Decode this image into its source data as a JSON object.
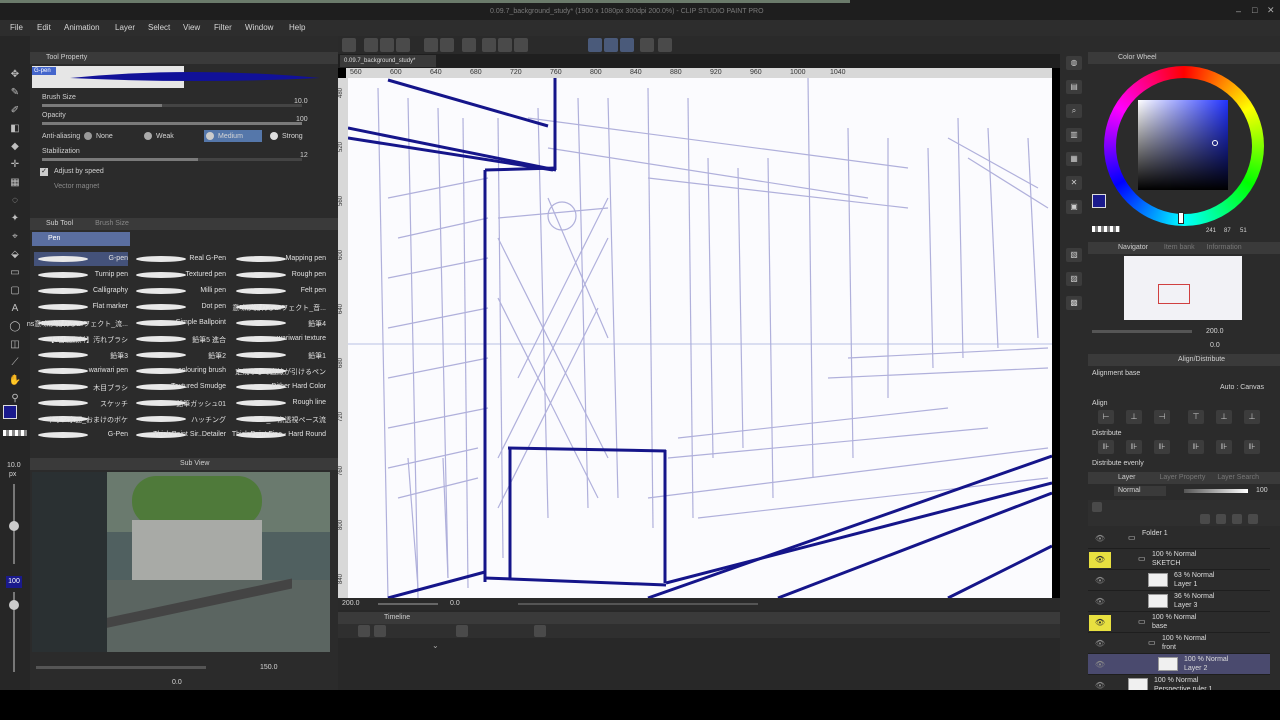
{
  "window": {
    "title": "0.09.7_background_study* (1900 x 1080px 300dpi 200.0%) - CLIP STUDIO PAINT PRO"
  },
  "menu": [
    "File",
    "Edit",
    "Animation",
    "Layer",
    "Select",
    "View",
    "Filter",
    "Window",
    "Help"
  ],
  "tool_property": {
    "title": "Tool Property",
    "brush_name": "G-pen",
    "brush_size_label": "Brush Size",
    "brush_size_value": "10.0",
    "opacity_label": "Opacity",
    "opacity_value": "100",
    "antialias_label": "Anti-aliasing",
    "antialias_options": [
      "None",
      "Weak",
      "Medium",
      "Strong"
    ],
    "antialias_selected": "Medium",
    "stabilization_label": "Stabilization",
    "stabilization_value": "12",
    "adjust_by_speed": "Adjust by speed",
    "vector_magnet": "Vector magnet"
  },
  "sub_tool": {
    "title": "Sub Tool",
    "tab2": "Brush Size",
    "group": "Pen",
    "col1": [
      "G-pen",
      "Turnip pen",
      "Calligraphy",
      "Flat marker",
      "ns意味が流れるエフェクト_流...",
      "【3日間無料】汚れブラシ",
      "鉛筆3",
      "wariwari pen",
      "木目ブラシ",
      "スケッチ",
      "ネオン水面_おまけのボケ",
      "G-Pen"
    ],
    "col2": [
      "Real G-Pen",
      "Textured pen",
      "Milli pen",
      "Dot pen",
      "Simple Ballpoint",
      "鉛筆5 進合",
      "鉛筆2",
      "colouring brush",
      "Textured Smudge",
      "鉛筆ガッシュ01",
      "ハッチング",
      "Thick Paint Sir..Detailer"
    ],
    "col3": [
      "Mapping pen",
      "Rough pen",
      "Felt pen",
      "意味が流れるエフェクト_音...",
      "鉛筆4",
      "wariwari texture",
      "鉛筆1",
      "定規なしで直線が引けるペン",
      "Dither Hard Color",
      "Rough line",
      "T_一点透視ペース流",
      "Thick Paint Fine - Hard Round"
    ]
  },
  "sub_view": {
    "title": "Sub View",
    "zoom": "150.0",
    "angle": "0.0"
  },
  "left_toolbar": {
    "brush_size": "10.0",
    "brush_unit": "px",
    "opacity": "100"
  },
  "canvas": {
    "tab_label": "0.09.7_background_study*",
    "ruler_marks": [
      "560",
      "600",
      "640",
      "680",
      "720",
      "760",
      "800",
      "840",
      "880",
      "920",
      "960",
      "1000",
      "1040"
    ],
    "vruler_marks": [
      "480",
      "520",
      "560",
      "600",
      "640",
      "680",
      "720",
      "760",
      "800",
      "840"
    ],
    "zoom": "200.0",
    "angle": "0.0"
  },
  "timeline": {
    "title": "Timeline"
  },
  "color_wheel": {
    "title": "Color Wheel",
    "values": [
      "241",
      "87",
      "51"
    ],
    "main_color": "#1a1a8c"
  },
  "navigator": {
    "title": "Navigator",
    "tab2": "Item bank",
    "tab3": "Information",
    "zoom": "200.0",
    "angle": "0.0"
  },
  "align": {
    "title": "Align/Distribute",
    "alignment_base": "Alignment base",
    "auto_canvas": "Auto : Canvas",
    "align_label": "Align",
    "distribute_label": "Distribute",
    "distribute_evenly": "Distribute evenly"
  },
  "layer_panel": {
    "title": "Layer",
    "tab2": "Layer Property",
    "tab3": "Layer Search",
    "blend": "Normal",
    "opacity": "100",
    "layers": [
      {
        "line1": "Folder 1",
        "line2": "",
        "eye": false,
        "selected": false,
        "indent": 0,
        "thumb": false
      },
      {
        "line1": "100 % Normal",
        "line2": "SKETCH",
        "eye": true,
        "selected": false,
        "indent": 1,
        "thumb": false
      },
      {
        "line1": "63 % Normal",
        "line2": "Layer 1",
        "eye": false,
        "selected": false,
        "indent": 2,
        "thumb": true
      },
      {
        "line1": "36 % Normal",
        "line2": "Layer 3",
        "eye": false,
        "selected": false,
        "indent": 2,
        "thumb": true
      },
      {
        "line1": "100 % Normal",
        "line2": "base",
        "eye": true,
        "selected": false,
        "indent": 1,
        "thumb": false
      },
      {
        "line1": "100 % Normal",
        "line2": "front",
        "eye": false,
        "selected": false,
        "indent": 2,
        "thumb": false
      },
      {
        "line1": "100 % Normal",
        "line2": "Layer 2",
        "eye": false,
        "selected": true,
        "indent": 3,
        "thumb": true
      },
      {
        "line1": "100 % Normal",
        "line2": "Perspective ruler 1",
        "eye": false,
        "selected": false,
        "indent": 0,
        "thumb": true
      }
    ]
  }
}
